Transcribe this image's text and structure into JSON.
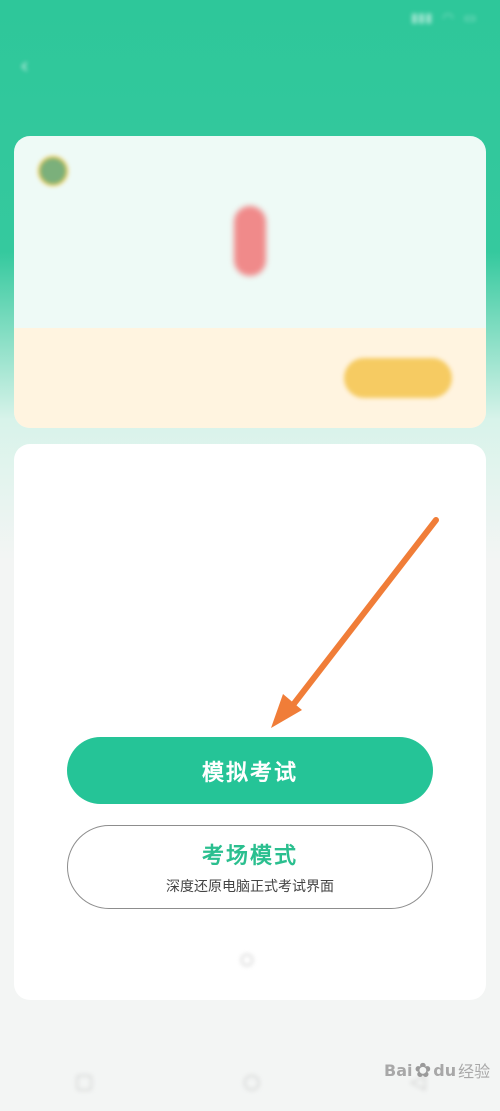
{
  "colors": {
    "brand_green": "#25c497",
    "accent_orange": "#f07d38",
    "promo_bg": "#fff4e0",
    "promo_button": "#f6cb62"
  },
  "status_bar": {
    "time": "",
    "icons": [
      "signal-icon",
      "wifi-icon",
      "battery-icon"
    ]
  },
  "nav": {
    "back_icon": "back-arrow-icon",
    "title": "",
    "right_label": ""
  },
  "summary_card": {
    "user_name": "",
    "records_label": "",
    "score_value": "0",
    "score_label": "",
    "promo": {
      "line1": "",
      "highlight": "",
      "line2": "",
      "button_label": ""
    }
  },
  "exam_info": {
    "rows": [
      {
        "key": "",
        "value": ""
      },
      {
        "key": "",
        "value": ""
      },
      {
        "key": "",
        "value": ""
      },
      {
        "key": "",
        "value": ""
      },
      {
        "key": "",
        "value": ""
      }
    ]
  },
  "actions": {
    "mock_exam_label": "模拟考试",
    "exam_mode_label": "考场模式",
    "exam_mode_sub": "深度还原电脑正式考试界面",
    "agreement_text": ""
  },
  "bottom_nav": {
    "icons": [
      "square-nav-icon",
      "circle-nav-icon",
      "back-nav-icon"
    ]
  },
  "watermark": {
    "text_left": "Bai",
    "text_right": "du",
    "text_cn": "经验"
  }
}
